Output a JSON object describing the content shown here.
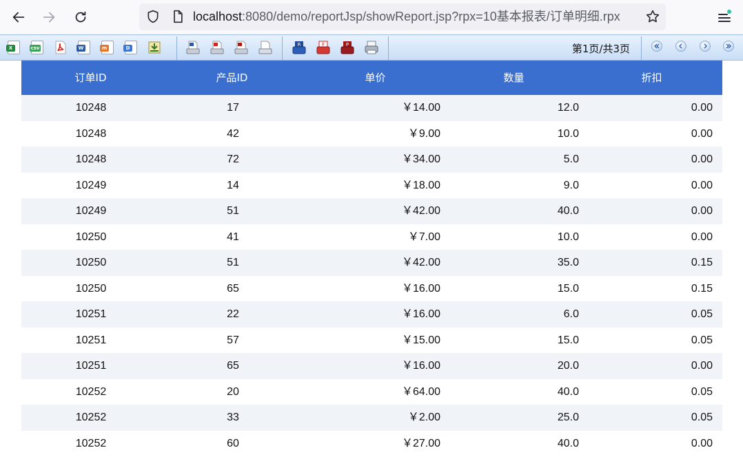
{
  "browser": {
    "url_host": "localhost",
    "url_rest": ":8080/demo/reportJsp/showReport.jsp?rpx=10基本报表/订单明细.rpx"
  },
  "toolbar": {
    "export_icons": [
      "excel-export-icon",
      "csv-export-icon",
      "pdf-export-icon",
      "word-export-icon",
      "html-export-icon",
      "xml-export-icon",
      "import-icon"
    ],
    "print_icons": [
      "print-excel-icon",
      "print-pdf-icon",
      "print-pdf-alt-icon",
      "print-preview-icon"
    ],
    "print_icons_2": [
      "print-a-icon",
      "print-f-icon",
      "print-p-icon",
      "printer-icon"
    ],
    "page_info": "第1页/共3页"
  },
  "table": {
    "headers": [
      "订单ID",
      "产品ID",
      "单价",
      "数量",
      "折扣"
    ],
    "rows": [
      [
        "10248",
        "17",
        "￥14.00",
        "12.0",
        "0.00"
      ],
      [
        "10248",
        "42",
        "￥9.00",
        "10.0",
        "0.00"
      ],
      [
        "10248",
        "72",
        "￥34.00",
        "5.0",
        "0.00"
      ],
      [
        "10249",
        "14",
        "￥18.00",
        "9.0",
        "0.00"
      ],
      [
        "10249",
        "51",
        "￥42.00",
        "40.0",
        "0.00"
      ],
      [
        "10250",
        "41",
        "￥7.00",
        "10.0",
        "0.00"
      ],
      [
        "10250",
        "51",
        "￥42.00",
        "35.0",
        "0.15"
      ],
      [
        "10250",
        "65",
        "￥16.00",
        "15.0",
        "0.15"
      ],
      [
        "10251",
        "22",
        "￥16.00",
        "6.0",
        "0.05"
      ],
      [
        "10251",
        "57",
        "￥15.00",
        "15.0",
        "0.05"
      ],
      [
        "10251",
        "65",
        "￥16.00",
        "20.0",
        "0.00"
      ],
      [
        "10252",
        "20",
        "￥64.00",
        "40.0",
        "0.05"
      ],
      [
        "10252",
        "33",
        "￥2.00",
        "25.0",
        "0.05"
      ],
      [
        "10252",
        "60",
        "￥27.00",
        "40.0",
        "0.00"
      ]
    ]
  }
}
